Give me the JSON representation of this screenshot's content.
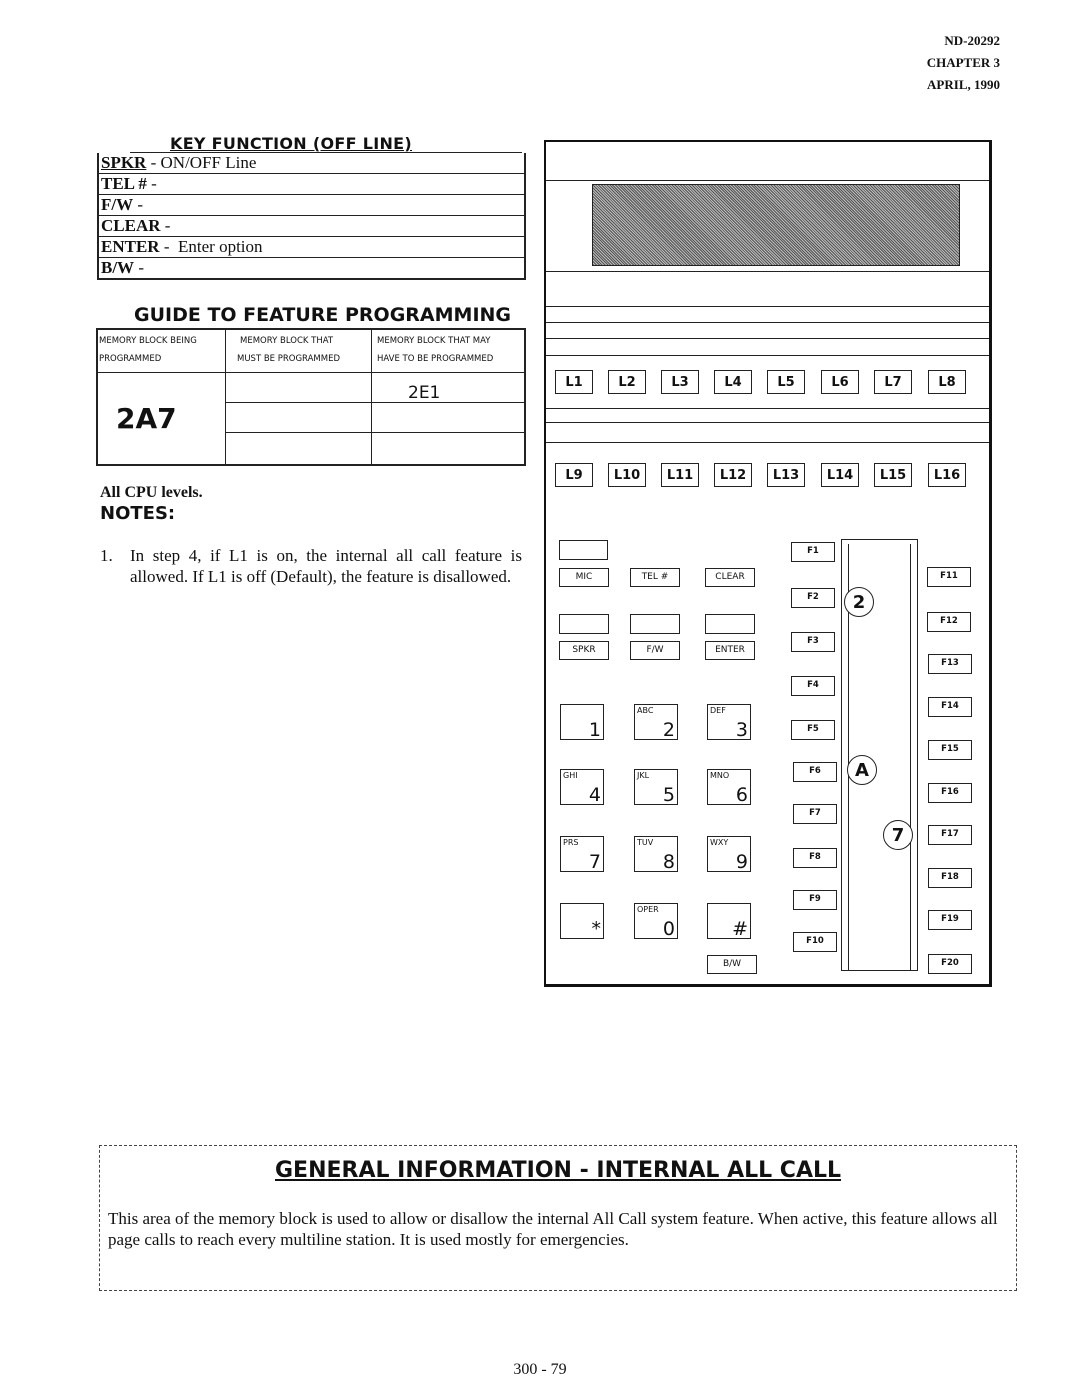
{
  "header": {
    "doc_number": "ND-20292",
    "chapter": "CHAPTER 3",
    "date": "APRIL, 1990"
  },
  "key_function": {
    "title": "KEY FUNCTION (OFF LINE)",
    "rows": [
      {
        "key": "SPKR",
        "sep": " - ",
        "desc": "ON/OFF Line"
      },
      {
        "key": "TEL #",
        "sep": " - ",
        "desc": ""
      },
      {
        "key": "F/W",
        "sep": " - ",
        "desc": ""
      },
      {
        "key": "CLEAR",
        "sep": " - ",
        "desc": ""
      },
      {
        "key": "ENTER",
        "sep": " -  ",
        "desc": "Enter option"
      },
      {
        "key": "B/W",
        "sep": " - ",
        "desc": ""
      }
    ]
  },
  "guide": {
    "title": "GUIDE TO FEATURE PROGRAMMING",
    "headers": [
      [
        "MEMORY BLOCK BEING",
        "PROGRAMMED"
      ],
      [
        "MEMORY BLOCK THAT",
        "MUST BE PROGRAMMED"
      ],
      [
        "MEMORY BLOCK THAT MAY",
        "HAVE TO BE PROGRAMMED"
      ]
    ],
    "block_programmed": "2A7",
    "must_be_programmed": [
      "",
      "",
      ""
    ],
    "may_have_to_be_programmed": [
      "2E1",
      "",
      ""
    ]
  },
  "cpu_levels": "All CPU levels.",
  "notes": {
    "title": "NOTES:",
    "items": [
      {
        "num": "1.",
        "text": "In step 4, if L1 is on, the internal all call feature is allowed.  If L1 is off (Default), the feature is disallowed."
      }
    ]
  },
  "phone": {
    "line_keys_row1": [
      "L1",
      "L2",
      "L3",
      "L4",
      "L5",
      "L6",
      "L7",
      "L8"
    ],
    "line_keys_row2": [
      "L9",
      "L10",
      "L11",
      "L12",
      "L13",
      "L14",
      "L15",
      "L16"
    ],
    "func_row1": [
      "MIC",
      "TEL #",
      "CLEAR"
    ],
    "func_row2": [
      "SPKR",
      "F/W",
      "ENTER"
    ],
    "dial_keys": [
      {
        "letters": "",
        "digit": "1"
      },
      {
        "letters": "ABC",
        "digit": "2"
      },
      {
        "letters": "DEF",
        "digit": "3"
      },
      {
        "letters": "GHI",
        "digit": "4"
      },
      {
        "letters": "JKL",
        "digit": "5"
      },
      {
        "letters": "MNO",
        "digit": "6"
      },
      {
        "letters": "PRS",
        "digit": "7"
      },
      {
        "letters": "TUV",
        "digit": "8"
      },
      {
        "letters": "WXY",
        "digit": "9"
      },
      {
        "letters": "",
        "digit": "*"
      },
      {
        "letters": "OPER",
        "digit": "0"
      },
      {
        "letters": "",
        "digit": "#"
      }
    ],
    "bw_key": "B/W",
    "f_keys_left": [
      "F1",
      "F2",
      "F3",
      "F4",
      "F5",
      "F6",
      "F7",
      "F8",
      "F9",
      "F10"
    ],
    "f_keys_right": [
      "F11",
      "F12",
      "F13",
      "F14",
      "F15",
      "F16",
      "F17",
      "F18",
      "F19",
      "F20"
    ],
    "step_markers": [
      "2",
      "A",
      "7"
    ]
  },
  "general_info": {
    "title": "GENERAL INFORMATION  -  INTERNAL  ALL  CALL",
    "body": "This area of the memory block is used to allow or disallow the internal All Call system feature.  When active, this feature allows all page calls to reach every multiline station.  It is used mostly for emergencies."
  },
  "page_number": "300 - 79"
}
